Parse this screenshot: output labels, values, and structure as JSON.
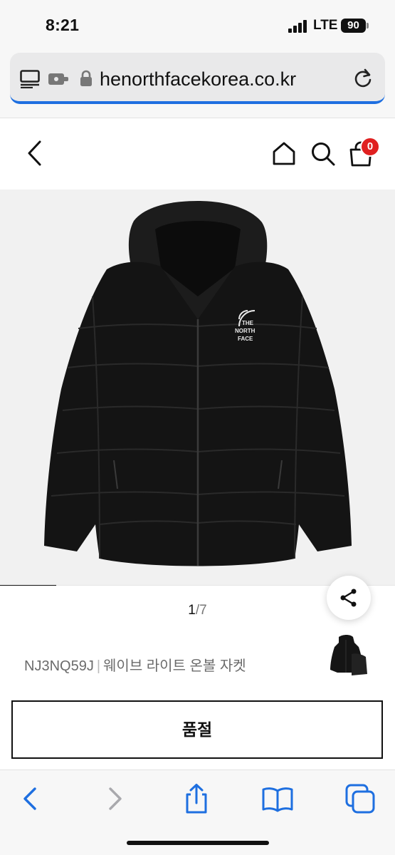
{
  "status_bar": {
    "time": "8:21",
    "network": "LTE",
    "battery": "90"
  },
  "browser": {
    "url_text": "henorthfacekorea.co.kr"
  },
  "header": {
    "cart_count": "0"
  },
  "gallery": {
    "current": "1",
    "separator": "/",
    "total": "7",
    "progress": 0.143
  },
  "product": {
    "code": "NJ3NQ59J",
    "separator": "|",
    "name": "웨이브 라이트 온볼 자켓"
  },
  "purchase": {
    "status_label": "품절"
  },
  "colors": {
    "accent": "#1e6fe0",
    "badge": "#e02020",
    "ink": "#111111"
  },
  "icons": [
    "reader-icon",
    "extension-icon",
    "lock-icon",
    "reload-icon",
    "back-icon",
    "home-icon",
    "search-icon",
    "cart-icon",
    "share-icon",
    "safari-back-icon",
    "safari-forward-icon",
    "share-sheet-icon",
    "bookmarks-icon",
    "tabs-icon"
  ]
}
